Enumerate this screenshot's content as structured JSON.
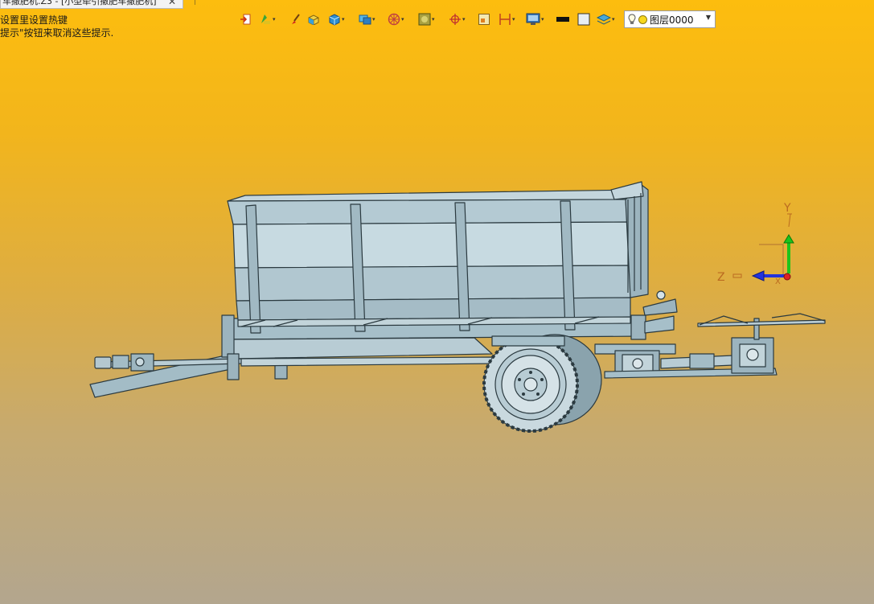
{
  "window": {
    "tab_title": "车撒肥机.Z3 - [小型牵引撒肥车撒肥机]",
    "tab_close": "✕"
  },
  "hints": {
    "line1": "设置里设置热键",
    "line2": "提示\"按钮来取消这些提示."
  },
  "toolbar": {
    "tools": [
      {
        "icon": "insert-icon",
        "has_dropdown": false
      },
      {
        "icon": "paint-icon",
        "has_dropdown": true
      },
      {
        "icon": "brush-icon",
        "has_dropdown": false
      },
      {
        "icon": "shaded-box-icon",
        "has_dropdown": false
      },
      {
        "icon": "solid-box-icon",
        "has_dropdown": true
      },
      {
        "icon": "render-mode-icon",
        "has_dropdown": true
      },
      {
        "icon": "wheel-icon",
        "has_dropdown": true
      },
      {
        "icon": "texture-icon",
        "has_dropdown": true
      },
      {
        "icon": "snap-target-icon",
        "has_dropdown": true
      },
      {
        "icon": "frame-icon",
        "has_dropdown": false
      },
      {
        "icon": "dimension-icon",
        "has_dropdown": true
      },
      {
        "icon": "screen-icon",
        "has_dropdown": true
      },
      {
        "icon": "line-color-icon",
        "has_dropdown": false
      },
      {
        "icon": "fill-color-icon",
        "has_dropdown": false
      },
      {
        "icon": "layers-icon",
        "has_dropdown": true
      }
    ],
    "layer": {
      "name": "图层0000",
      "color": "#f7d71e"
    }
  },
  "triad": {
    "y_label": "Y",
    "z_label": "Z",
    "x_label": "X",
    "y_color": "#1cc41c",
    "z_color": "#2233dd",
    "x_color": "#dd2222"
  },
  "colors": {
    "background_top": "#fdbd0e",
    "background_bottom": "#b3a68e",
    "model_fill": "#a9c1cb",
    "model_stroke": "#2b3a40"
  }
}
